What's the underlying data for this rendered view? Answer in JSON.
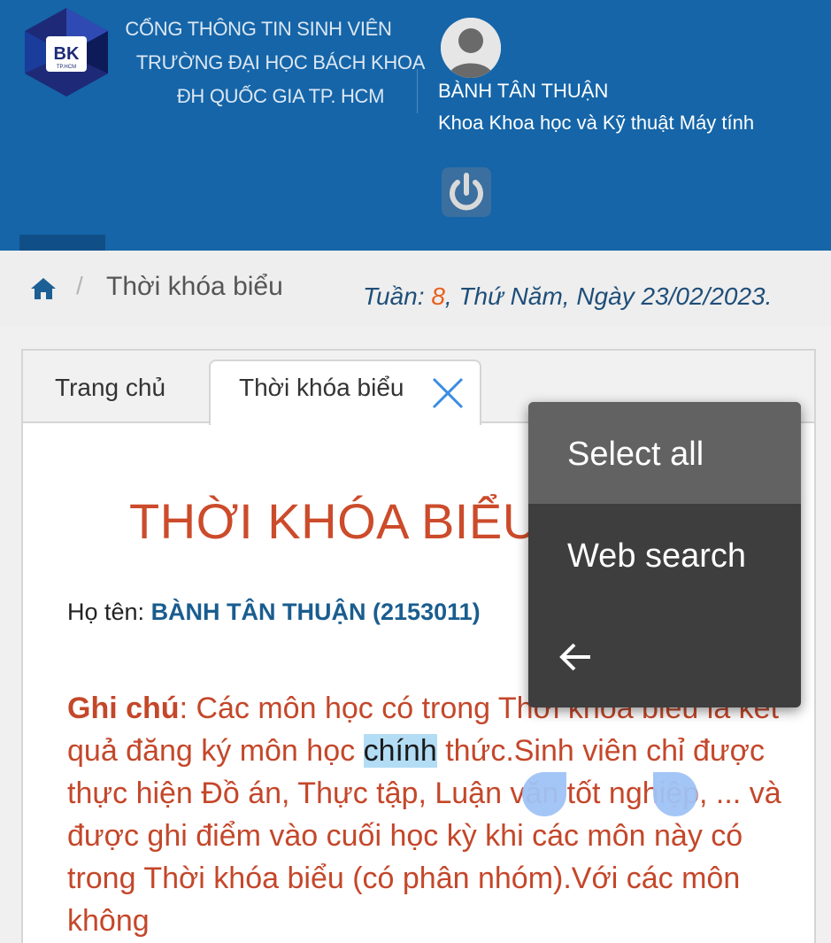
{
  "header": {
    "school_lines": [
      "CỔNG THÔNG TIN SINH VIÊN",
      "TRƯỜNG ĐẠI HỌC BÁCH KHOA",
      "ĐH QUỐC GIA TP. HCM"
    ],
    "logo_text": "BK",
    "logo_sub": "TP.HCM",
    "user_name": "BÀNH TÂN THUẬN",
    "faculty": "Khoa Khoa học và Kỹ thuật Máy tính"
  },
  "breadcrumb": {
    "current": "Thời khóa biểu",
    "separator": "/"
  },
  "weekinfo": {
    "prefix": "Tuần: ",
    "week": "8",
    "suffix": ", Thứ Năm, Ngày 23/02/2023."
  },
  "tabs": {
    "home": "Trang chủ",
    "active": "Thời khóa biểu"
  },
  "page": {
    "title": "THỜI KHÓA BIỂU",
    "student_label": "Họ tên: ",
    "student_value": "BÀNH TÂN THUẬN (2153011)"
  },
  "note": {
    "label": "Ghi chú",
    "text_before": ": Các môn học có trong Thời khóa biểu là kết quả đăng ký môn học ",
    "selected": "chính",
    "text_after": " thức.Sinh viên chỉ được thực hiện Đồ án, Thực tập, Luận văn tốt nghiệp, ... và được ghi điểm vào cuối học kỳ khi các môn này có trong Thời khóa biểu (có phân nhóm).Với các môn không"
  },
  "context_menu": {
    "items": [
      "Select all",
      "Web search"
    ],
    "back_icon": "arrow-left-icon"
  },
  "colors": {
    "header_bg": "#1565a8",
    "title_red": "#cc4b2b",
    "week_orange": "#e8611c",
    "selection": "#b3dcf5"
  }
}
